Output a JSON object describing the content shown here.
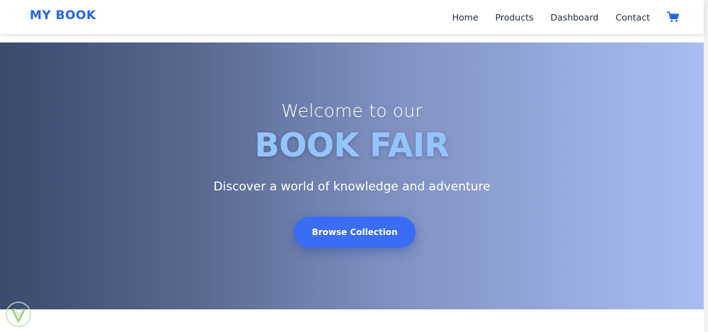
{
  "navbar": {
    "brand": "MY BOOK",
    "links": [
      "Home",
      "Products",
      "Dashboard",
      "Contact"
    ],
    "cart_icon": "shopping-cart-icon"
  },
  "hero": {
    "line1": "Welcome to our",
    "title": "BOOK FAIR",
    "subtitle": "Discover a world of knowledge and adventure",
    "cta_label": "Browse Collection"
  },
  "colors": {
    "brand": "#2563eb",
    "hero_title": "#93c5fd",
    "cta": "#3b6cf6",
    "gradient_start": "#3c4a6e",
    "gradient_end": "#aabdf2"
  }
}
